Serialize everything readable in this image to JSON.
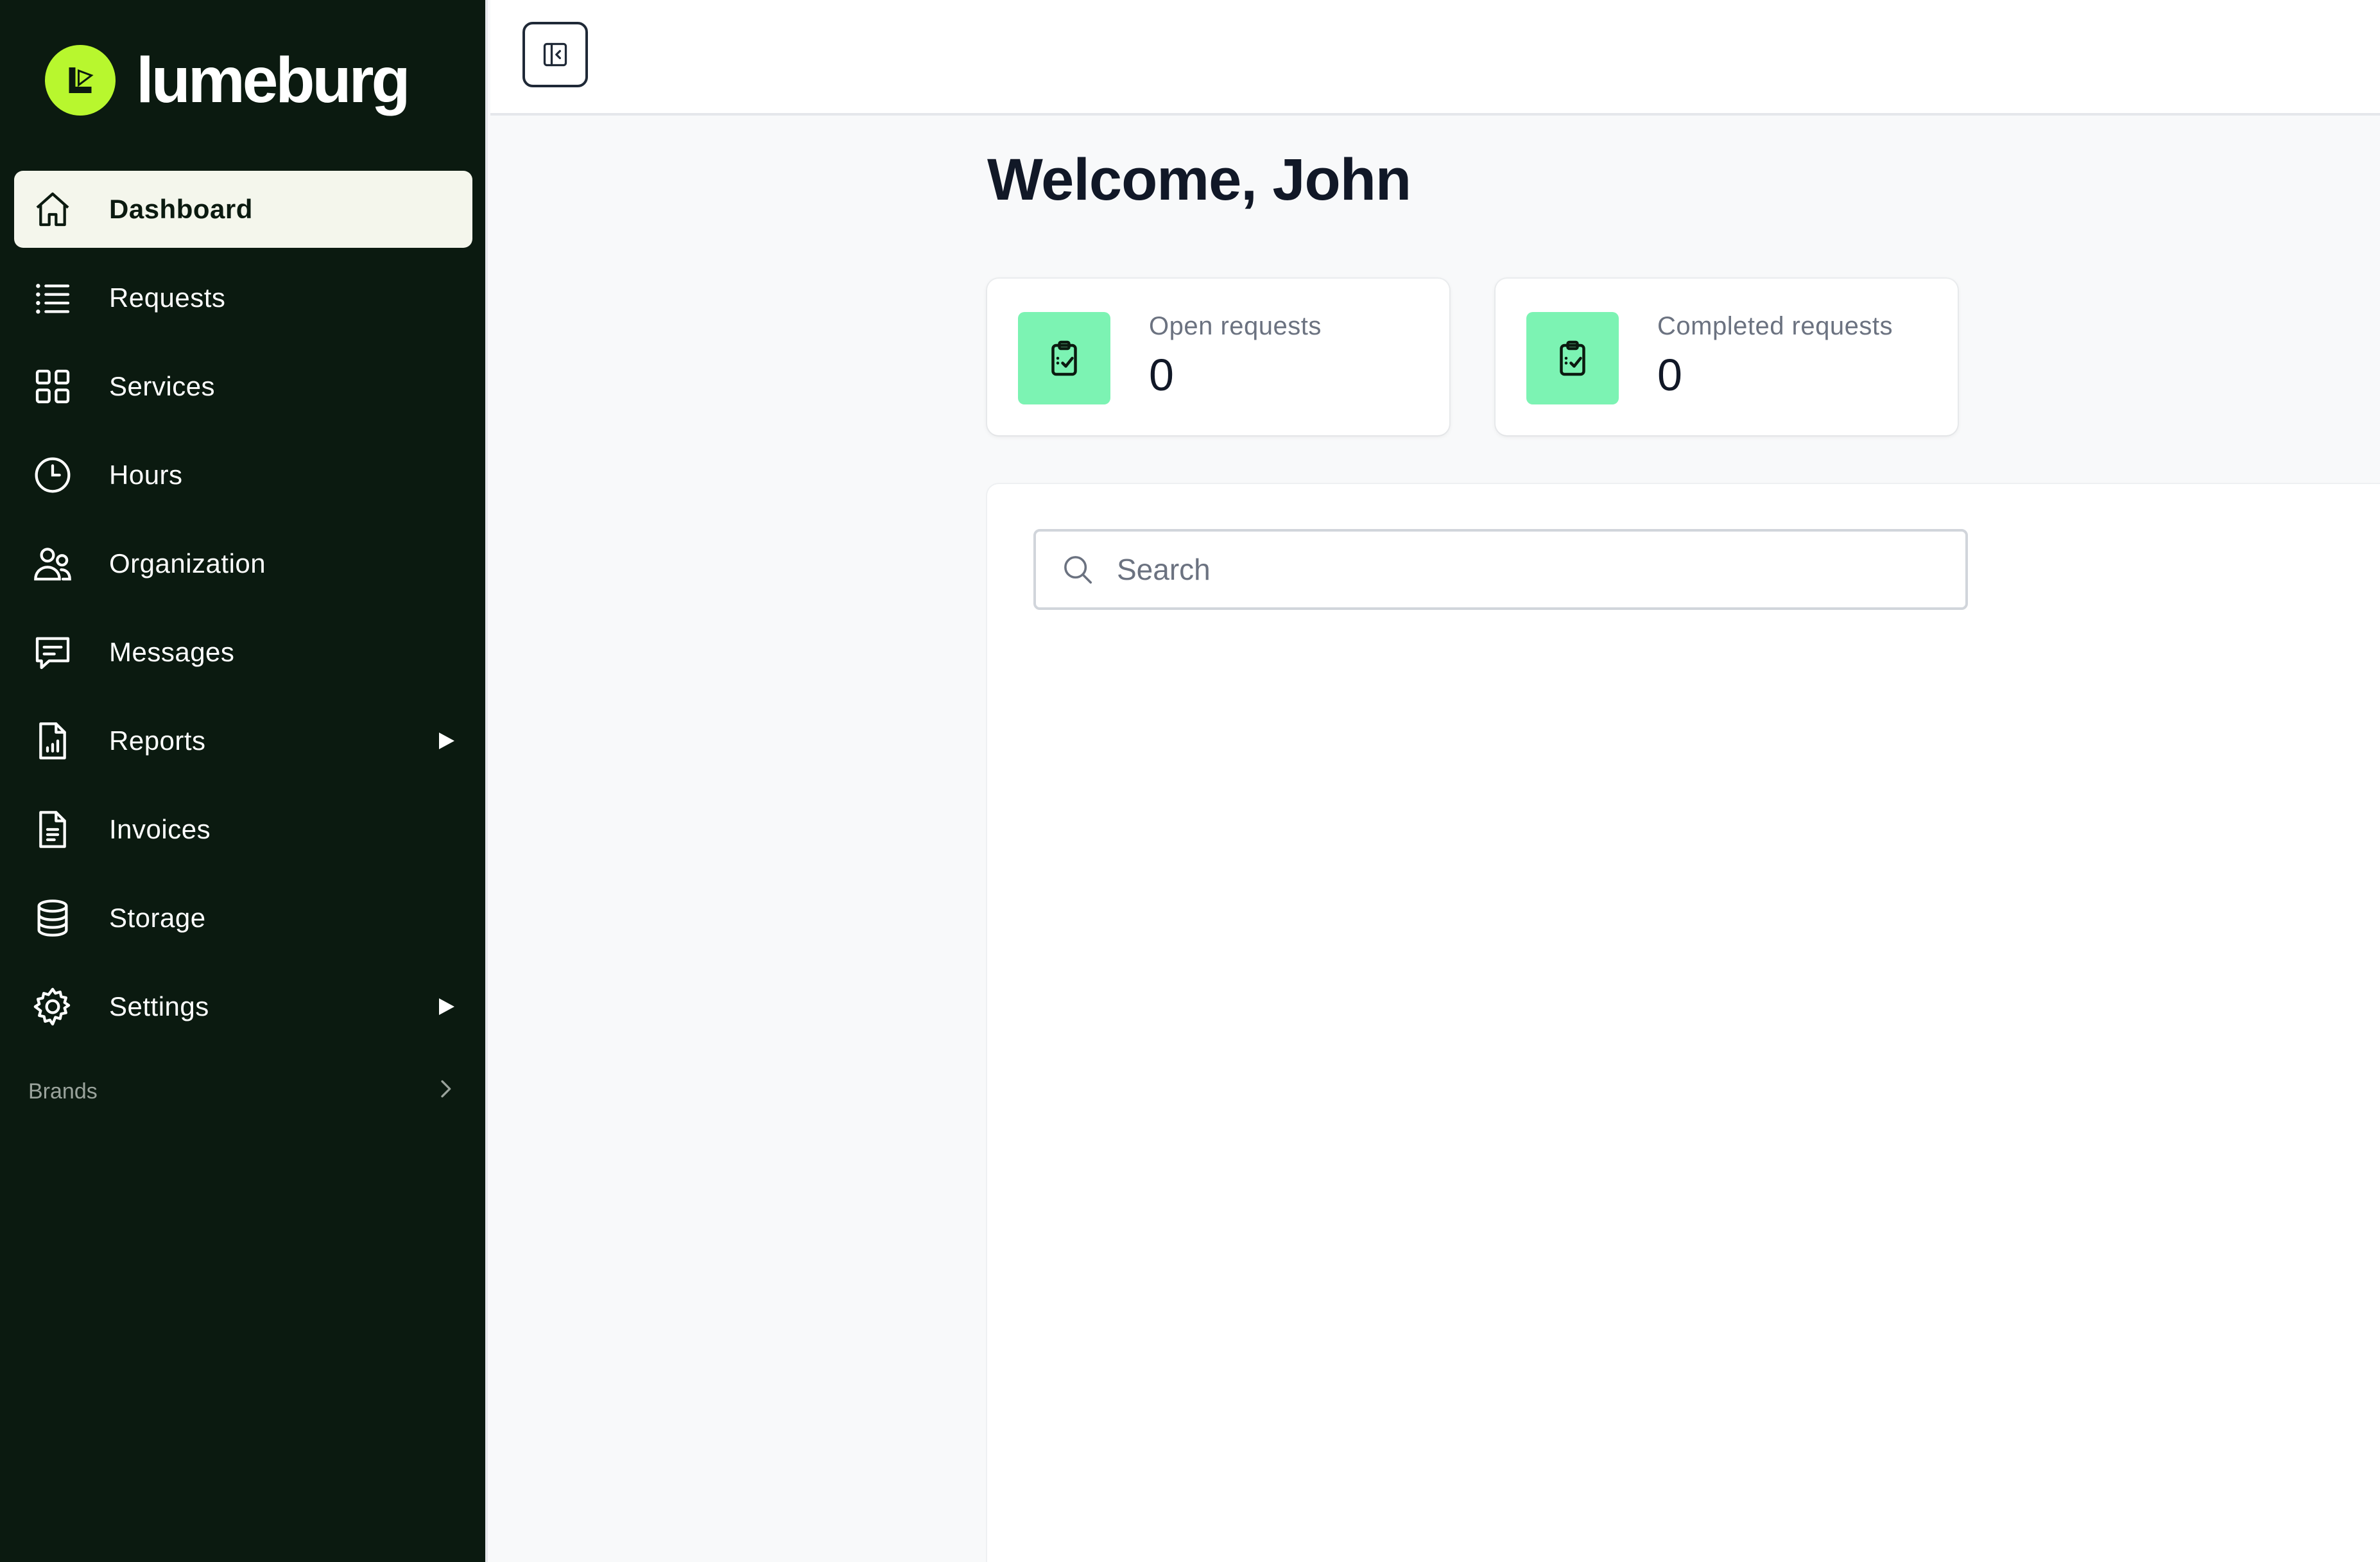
{
  "brand": {
    "name": "lumeburg",
    "accent": "#b8f72e",
    "sidebar_bg": "#0b1a10"
  },
  "sidebar": {
    "items": [
      {
        "label": "Dashboard",
        "icon": "home-icon",
        "active": true
      },
      {
        "label": "Requests",
        "icon": "list-icon"
      },
      {
        "label": "Services",
        "icon": "grid-icon"
      },
      {
        "label": "Hours",
        "icon": "clock-icon"
      },
      {
        "label": "Organization",
        "icon": "users-icon"
      },
      {
        "label": "Messages",
        "icon": "message-icon"
      },
      {
        "label": "Reports",
        "icon": "report-icon",
        "expandable": true
      },
      {
        "label": "Invoices",
        "icon": "invoice-icon"
      },
      {
        "label": "Storage",
        "icon": "database-icon"
      },
      {
        "label": "Settings",
        "icon": "gear-icon",
        "expandable": true
      }
    ],
    "brands_label": "Brands"
  },
  "main": {
    "welcome": "Welcome, John",
    "stats": [
      {
        "label": "Open requests",
        "value": "0",
        "icon": "clipboard-check-icon"
      },
      {
        "label": "Completed requests",
        "value": "0",
        "icon": "clipboard-check-icon"
      }
    ],
    "search": {
      "placeholder": "Search",
      "value": ""
    },
    "stat_icon_bg": "#7cf3b3"
  }
}
